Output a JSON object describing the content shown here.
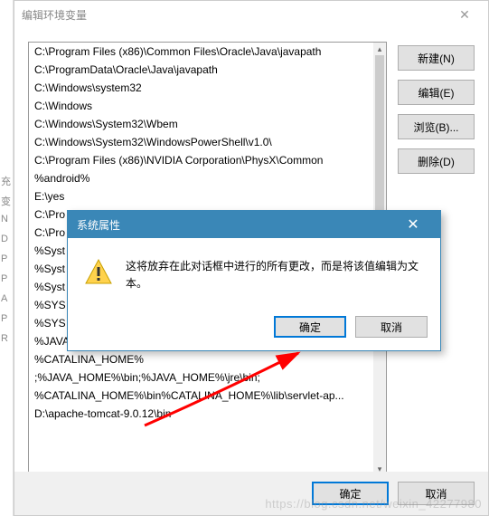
{
  "main": {
    "title": "编辑环境变量",
    "listItems": [
      "C:\\Program Files (x86)\\Common Files\\Oracle\\Java\\javapath",
      "C:\\ProgramData\\Oracle\\Java\\javapath",
      "C:\\Windows\\system32",
      "C:\\Windows",
      "C:\\Windows\\System32\\Wbem",
      "C:\\Windows\\System32\\WindowsPowerShell\\v1.0\\",
      "C:\\Program Files (x86)\\NVIDIA Corporation\\PhysX\\Common",
      "%android%",
      "E:\\yes",
      "C:\\Pro",
      "C:\\Pro",
      "%Syst",
      "%Syst",
      "%Syst",
      "%SYS",
      "%SYS",
      "%JAVA_HOME%\\bin",
      "%CATALINA_HOME%",
      ";%JAVA_HOME%\\bin;%JAVA_HOME%\\jre\\bin;",
      "%CATALINA_HOME%\\bin%CATALINA_HOME%\\lib\\servlet-ap...",
      "D:\\apache-tomcat-9.0.12\\bin"
    ],
    "buttons": {
      "new": "新建(N)",
      "edit": "编辑(E)",
      "browse": "浏览(B)...",
      "delete": "删除(D)"
    },
    "bottom": {
      "ok": "确定",
      "cancel": "取消"
    }
  },
  "popup": {
    "title": "系统属性",
    "message": "这将放弃在此对话框中进行的所有更改，而是将该值编辑为文本。",
    "ok": "确定",
    "cancel": "取消"
  },
  "leftStrip": [
    "充",
    "变",
    "N",
    "D",
    "P",
    "P",
    "A",
    "P",
    "R"
  ],
  "watermark": "https://blog.csdn.net/weixin_42277980"
}
